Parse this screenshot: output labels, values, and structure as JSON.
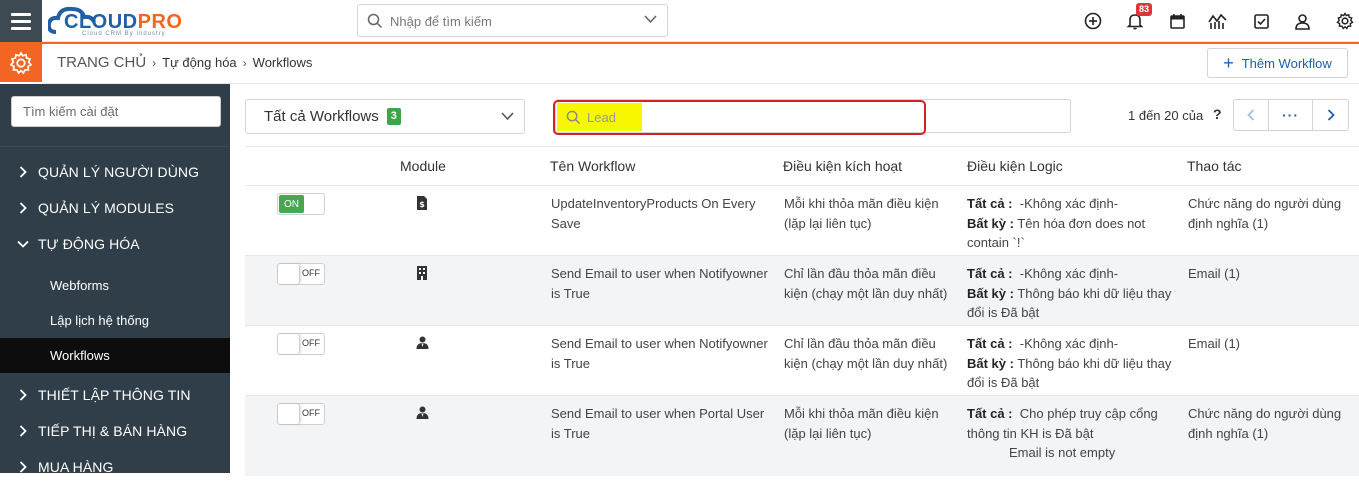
{
  "app": {
    "logo_main": "CLOUD",
    "logo_accent": "PRO",
    "logo_tagline": "Cloud CRM By Industry"
  },
  "header": {
    "search_placeholder": "Nhập để tìm kiếm",
    "notification_count": "83",
    "icons": [
      "plus-circle-icon",
      "bell-icon",
      "calendar-icon",
      "chart-icon",
      "checkbox-icon",
      "user-icon",
      "gear-icon"
    ]
  },
  "breadcrumb": {
    "home": "TRANG CHỦ",
    "level1": "Tự động hóa",
    "level2": "Workflows",
    "separator": "›"
  },
  "add_button": "Thêm Workflow",
  "sidebar": {
    "search_placeholder": "Tìm kiếm cài đặt",
    "sections": [
      {
        "label": "QUẢN LÝ NGƯỜI DÙNG",
        "expanded": false
      },
      {
        "label": "QUẢN LÝ MODULES",
        "expanded": false
      },
      {
        "label": "TỰ ĐỘNG HÓA",
        "expanded": true
      },
      {
        "label": "THIẾT LẬP THÔNG TIN",
        "expanded": false
      },
      {
        "label": "TIẾP THỊ & BÁN HÀNG",
        "expanded": false
      },
      {
        "label": "MUA HÀNG",
        "expanded": false
      }
    ],
    "sub_items": [
      {
        "label": "Webforms",
        "active": false
      },
      {
        "label": "Lập lịch hệ thống",
        "active": false
      },
      {
        "label": "Workflows",
        "active": true
      }
    ]
  },
  "filter": {
    "select_label": "Tất cả Workflows",
    "select_count": "3",
    "search_value": "Lead",
    "pager_text": "1 đến 20 của",
    "pager_help": "?",
    "more": "···"
  },
  "table": {
    "headers": [
      "Module",
      "Tên Workflow",
      "Điều kiện kích hoạt",
      "Điều kiện Logic",
      "Thao tác"
    ],
    "rows": [
      {
        "status": "ON",
        "module_icon": "invoice-icon",
        "name": "UpdateInventoryProducts On Every Save",
        "trigger": "Mỗi khi thỏa mãn điều kiện (lặp lại liên tục)",
        "all_label": "Tất cả :",
        "all_text": "-Không xác định-",
        "any_label": "Bất kỳ :",
        "any_text": "Tên hóa đơn does not contain `!`",
        "action": "Chức năng do người dùng định nghĩa (1)"
      },
      {
        "status": "OFF",
        "module_icon": "building-icon",
        "name": "Send Email to user when Notifyowner is True",
        "trigger": "Chỉ lần đầu thỏa mãn điều kiện (chạy một lần duy nhất)",
        "all_label": "Tất cả :",
        "all_text": "-Không xác định-",
        "any_label": "Bất kỳ :",
        "any_text": "Thông báo khi dữ liệu thay đổi is Đã bật",
        "action": "Email (1)"
      },
      {
        "status": "OFF",
        "module_icon": "contact-icon",
        "name": "Send Email to user when Notifyowner is True",
        "trigger": "Chỉ lần đầu thỏa mãn điều kiện (chạy một lần duy nhất)",
        "all_label": "Tất cả :",
        "all_text": "-Không xác định-",
        "any_label": "Bất kỳ :",
        "any_text": "Thông báo khi dữ liệu thay đổi is Đã bật",
        "action": "Email (1)"
      },
      {
        "status": "OFF",
        "module_icon": "contact-icon",
        "name": "Send Email to user when Portal User is True",
        "trigger": "Mỗi khi thỏa mãn điều kiện (lặp lại liên tục)",
        "all_label": "Tất cả :",
        "all_text": "Cho phép truy cập cổng thông tin KH is Đã bật",
        "all_text_2": "Email is not empty",
        "action": "Chức năng do người dùng định nghĩa (1)"
      }
    ]
  },
  "colors": {
    "accent": "#f26522",
    "brand": "#1f5fa8",
    "sidebar": "#2f3e48",
    "toggle_on": "#46a651",
    "highlight": "#f7f700",
    "outline": "#d61f26"
  }
}
